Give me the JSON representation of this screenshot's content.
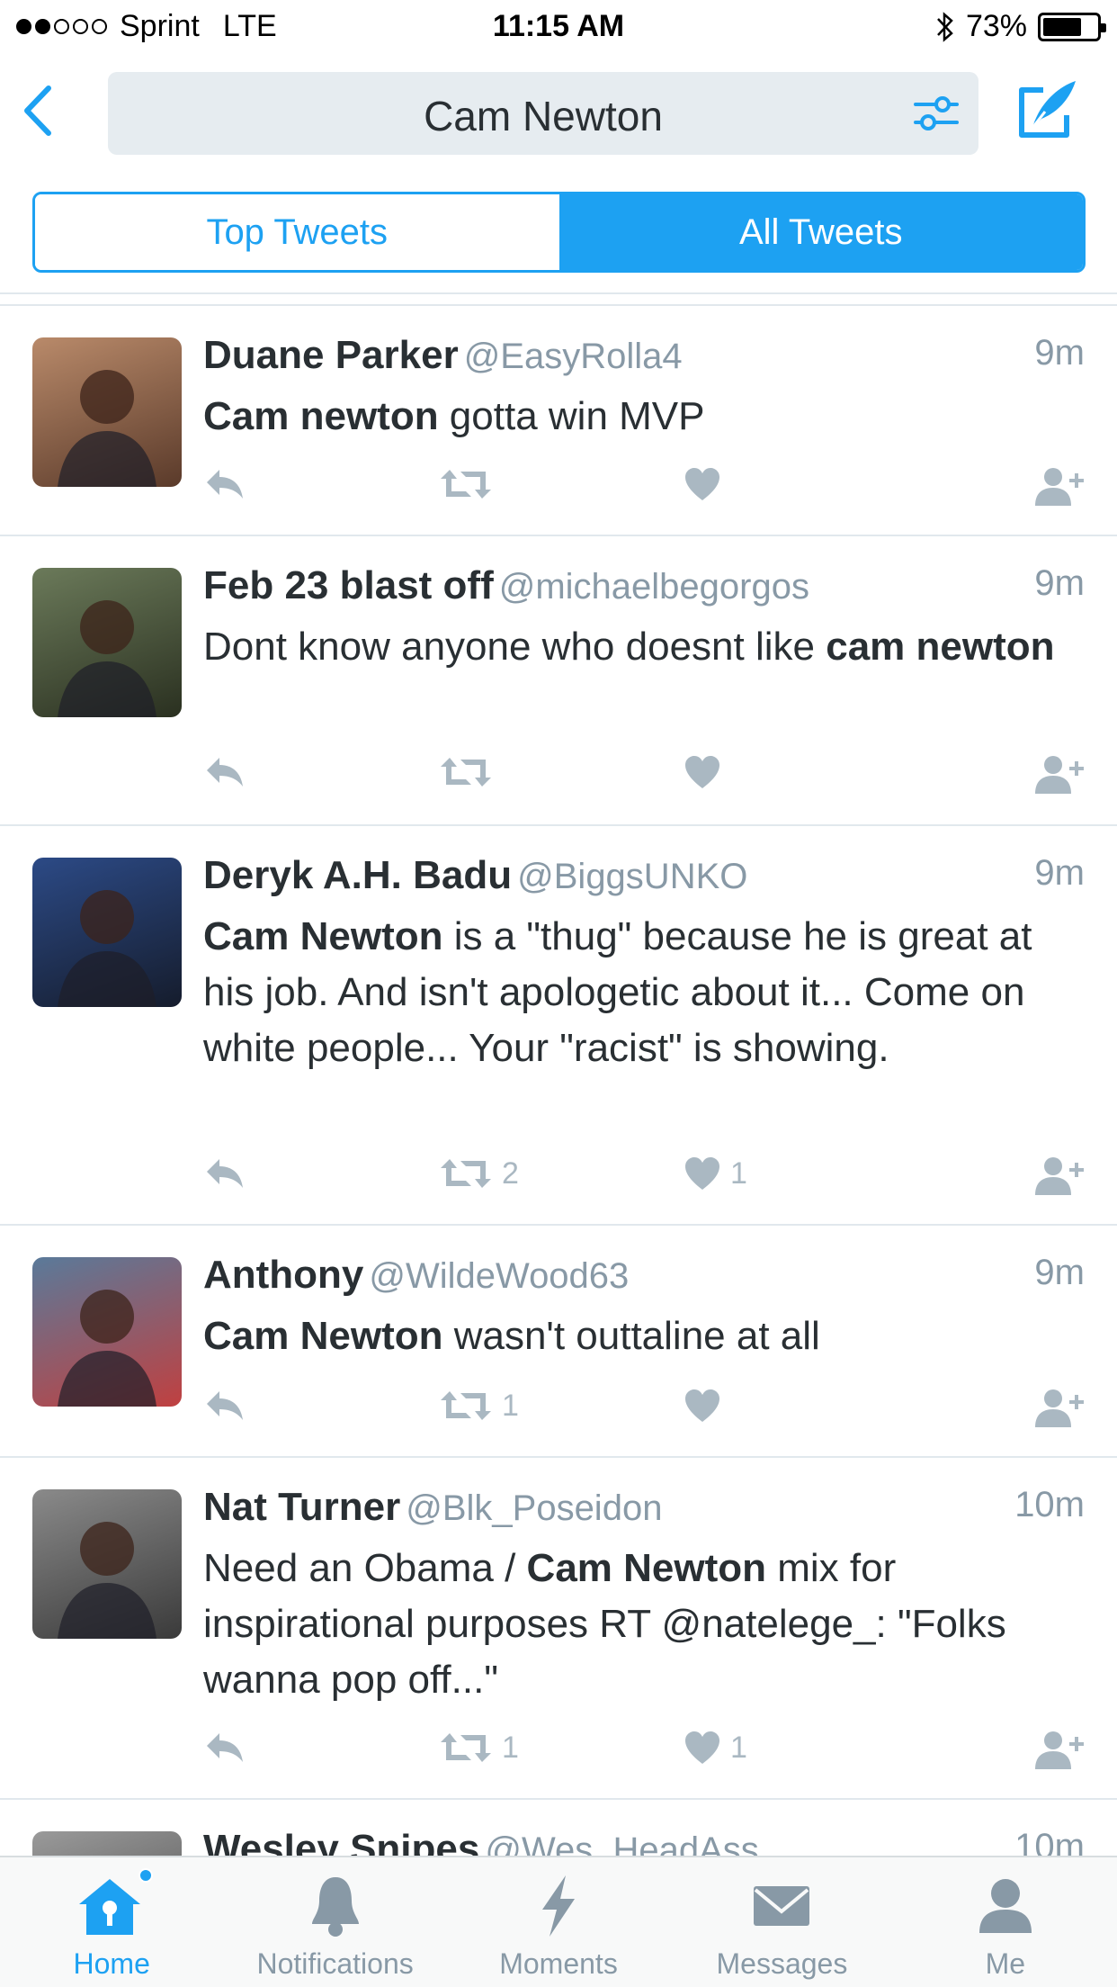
{
  "status_bar": {
    "carrier": "Sprint",
    "network": "LTE",
    "time": "11:15 AM",
    "battery": "73%",
    "battery_level": 0.73,
    "signal_bars_filled": 2,
    "signal_bars_total": 5
  },
  "nav": {
    "search_query": "Cam Newton",
    "back_icon": "chevron-left-icon",
    "filter_icon": "sliders-icon",
    "compose_icon": "compose-icon"
  },
  "segments": {
    "top_label": "Top Tweets",
    "all_label": "All Tweets",
    "selected": "All Tweets"
  },
  "tweets": [
    {
      "name": "Duane Parker",
      "handle": "@EasyRolla4",
      "time": "9m",
      "text_parts": [
        {
          "t": "Cam newton",
          "b": true
        },
        {
          "t": " gotta win MVP",
          "b": false
        }
      ],
      "retweets": "",
      "likes": ""
    },
    {
      "name": "Feb 23 blast off",
      "handle": "@michaelbegorgos",
      "time": "9m",
      "text_parts": [
        {
          "t": "Dont know anyone who doesnt like ",
          "b": false
        },
        {
          "t": "cam newton",
          "b": true
        }
      ],
      "retweets": "",
      "likes": ""
    },
    {
      "name": "Deryk A.H. Badu",
      "handle": "@BiggsUNKO",
      "time": "9m",
      "text_parts": [
        {
          "t": "Cam Newton",
          "b": true
        },
        {
          "t": " is a \"thug\" because he is great at his job. And isn't apologetic about it... Come on white people... Your \"racist\" is showing.",
          "b": false
        }
      ],
      "retweets": "2",
      "likes": "1"
    },
    {
      "name": "Anthony",
      "handle": "@WildeWood63",
      "time": "9m",
      "text_parts": [
        {
          "t": "Cam Newton",
          "b": true
        },
        {
          "t": " wasn't outtaline at all",
          "b": false
        }
      ],
      "retweets": "1",
      "likes": ""
    },
    {
      "name": "Nat Turner",
      "handle": "@Blk_Poseidon",
      "time": "10m",
      "text_parts": [
        {
          "t": "Need an Obama / ",
          "b": false
        },
        {
          "t": "Cam Newton",
          "b": true
        },
        {
          "t": " mix for inspirational purposes RT @natelege_: \"Folks wanna pop off...\"",
          "b": false
        }
      ],
      "retweets": "1",
      "likes": "1"
    },
    {
      "name": "Wesley Snipes",
      "handle": "@Wes_HeadAss",
      "time": "10m",
      "text_parts": [],
      "retweets": "",
      "likes": ""
    }
  ],
  "tabbar": {
    "items": [
      {
        "label": "Home",
        "icon": "home-icon",
        "active": true
      },
      {
        "label": "Notifications",
        "icon": "bell-icon",
        "active": false
      },
      {
        "label": "Moments",
        "icon": "lightning-icon",
        "active": false
      },
      {
        "label": "Messages",
        "icon": "envelope-icon",
        "active": false
      },
      {
        "label": "Me",
        "icon": "person-icon",
        "active": false
      }
    ]
  },
  "colors": {
    "accent": "#1da1f2",
    "text": "#292f33",
    "muted": "#8899a6",
    "icon_gray": "#aab8c2",
    "divider": "#e1e8ed",
    "search_bg": "#e6ecf0"
  }
}
